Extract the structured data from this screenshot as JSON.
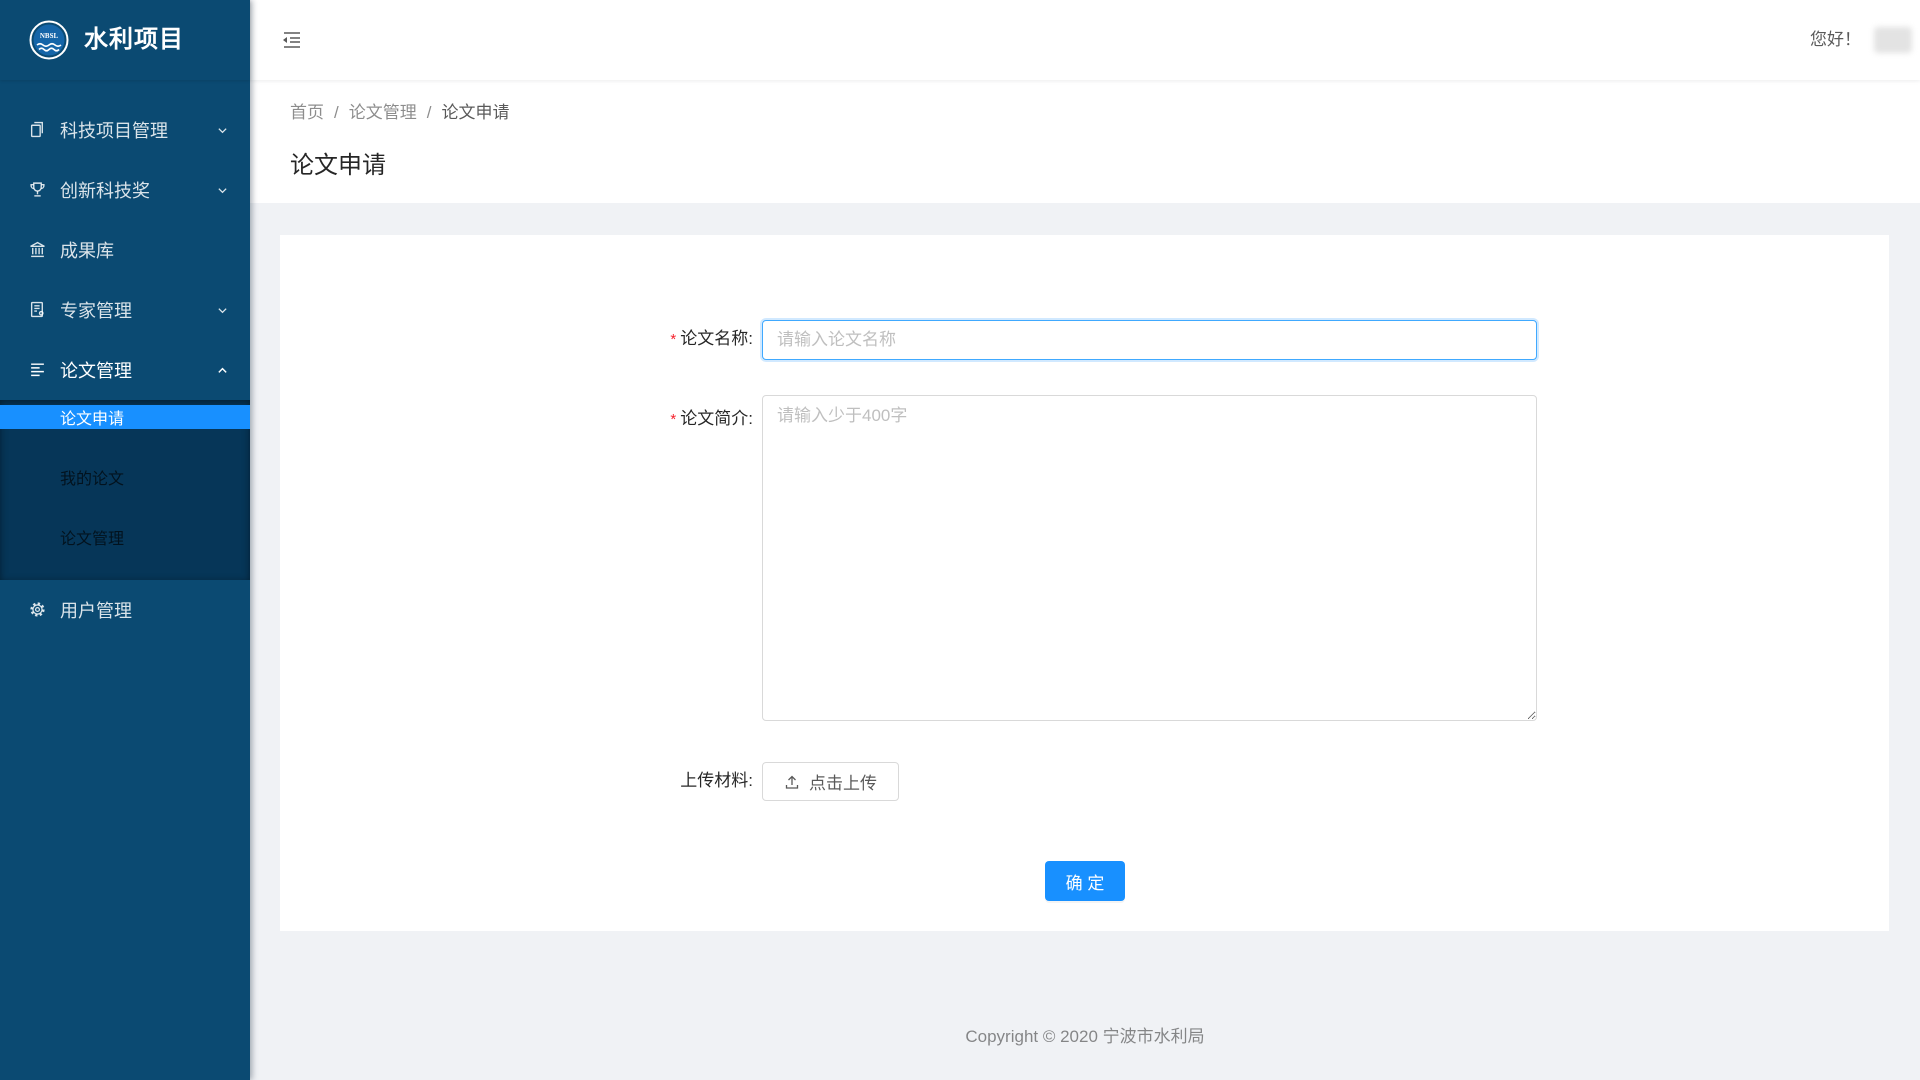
{
  "app": {
    "title": "水利项目",
    "logo_text": "NBSL"
  },
  "header": {
    "greeting": "您好！"
  },
  "sidebar": {
    "items": [
      {
        "label": "科技项目管理",
        "icon": "copy-icon",
        "expandable": true
      },
      {
        "label": "创新科技奖",
        "icon": "trophy-icon",
        "expandable": true
      },
      {
        "label": "成果库",
        "icon": "bank-icon"
      },
      {
        "label": "专家管理",
        "icon": "profile-icon",
        "expandable": true
      },
      {
        "label": "论文管理",
        "icon": "bars-icon",
        "expanded": true,
        "children": [
          {
            "label": "论文申请",
            "active": true
          },
          {
            "label": "我的论文"
          },
          {
            "label": "论文管理"
          }
        ]
      },
      {
        "label": "用户管理",
        "icon": "setting-icon"
      }
    ]
  },
  "breadcrumb": [
    "首页",
    "论文管理",
    "论文申请"
  ],
  "breadcrumb_separator": "/",
  "page_title": "论文申请",
  "form": {
    "required_mark": "*",
    "name": {
      "label": "论文名称:",
      "required": true,
      "placeholder": "请输入论文名称"
    },
    "summary": {
      "label": "论文简介:",
      "required": true,
      "placeholder": "请输入少于400字"
    },
    "upload": {
      "label": "上传材料:",
      "button_label": "点击上传",
      "icon": "upload-icon"
    },
    "submit_label": "确 定"
  },
  "footer": {
    "copyright": "Copyright © 2020 宁波市水利局"
  },
  "colors": {
    "sidebar_bg": "#0b4a72",
    "submenu_bg": "#063658",
    "primary": "#1890ff",
    "required": "#f5222d",
    "page_bg": "#f0f2f5"
  }
}
